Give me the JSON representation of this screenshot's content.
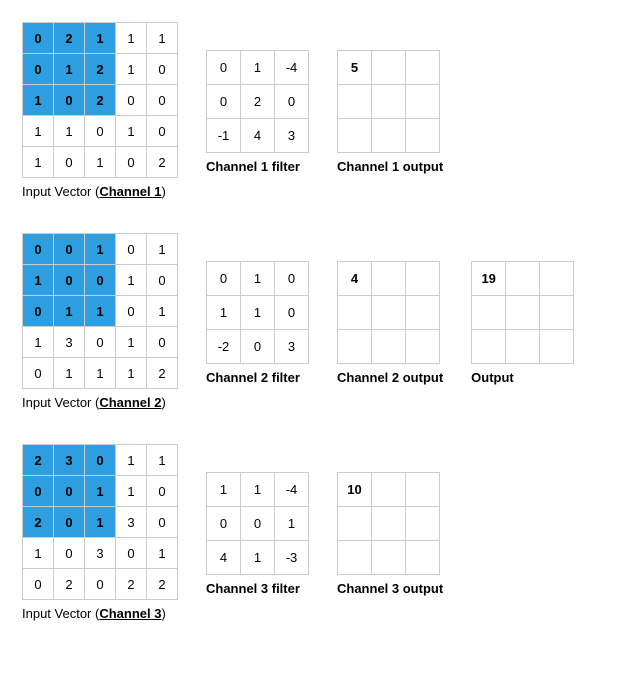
{
  "channels": [
    {
      "input": {
        "rows": [
          [
            0,
            2,
            1,
            1,
            1
          ],
          [
            0,
            1,
            2,
            1,
            0
          ],
          [
            1,
            0,
            2,
            0,
            0
          ],
          [
            1,
            1,
            0,
            1,
            0
          ],
          [
            1,
            0,
            1,
            0,
            2
          ]
        ],
        "highlight": [
          [
            0,
            0
          ],
          [
            0,
            1
          ],
          [
            0,
            2
          ],
          [
            1,
            0
          ],
          [
            1,
            1
          ],
          [
            1,
            2
          ],
          [
            2,
            0
          ],
          [
            2,
            1
          ],
          [
            2,
            2
          ]
        ],
        "caption_prefix": "Input Vector (",
        "caption_channel": "Channel 1",
        "caption_suffix": ")"
      },
      "filter": {
        "rows": [
          [
            0,
            1,
            -4
          ],
          [
            0,
            2,
            0
          ],
          [
            -1,
            4,
            3
          ]
        ],
        "caption": "Channel 1 filter"
      },
      "output": {
        "rows": [
          [
            5,
            "",
            ""
          ],
          [
            "",
            "",
            ""
          ],
          [
            "",
            "",
            ""
          ]
        ],
        "caption": "Channel 1 output"
      }
    },
    {
      "input": {
        "rows": [
          [
            0,
            0,
            1,
            0,
            1
          ],
          [
            1,
            0,
            0,
            1,
            0
          ],
          [
            0,
            1,
            1,
            0,
            1
          ],
          [
            1,
            3,
            0,
            1,
            0
          ],
          [
            0,
            1,
            1,
            1,
            2
          ]
        ],
        "highlight": [
          [
            0,
            0
          ],
          [
            0,
            1
          ],
          [
            0,
            2
          ],
          [
            1,
            0
          ],
          [
            1,
            1
          ],
          [
            1,
            2
          ],
          [
            2,
            0
          ],
          [
            2,
            1
          ],
          [
            2,
            2
          ]
        ],
        "caption_prefix": "Input Vector (",
        "caption_channel": "Channel 2",
        "caption_suffix": ")"
      },
      "filter": {
        "rows": [
          [
            0,
            1,
            0
          ],
          [
            1,
            1,
            0
          ],
          [
            -2,
            0,
            3
          ]
        ],
        "caption": "Channel 2 filter"
      },
      "output": {
        "rows": [
          [
            4,
            "",
            ""
          ],
          [
            "",
            "",
            ""
          ],
          [
            "",
            "",
            ""
          ]
        ],
        "caption": "Channel 2 output"
      },
      "final_output": {
        "rows": [
          [
            19,
            "",
            ""
          ],
          [
            "",
            "",
            ""
          ],
          [
            "",
            "",
            ""
          ]
        ],
        "caption": "Output"
      }
    },
    {
      "input": {
        "rows": [
          [
            2,
            3,
            0,
            1,
            1
          ],
          [
            0,
            0,
            1,
            1,
            0
          ],
          [
            2,
            0,
            1,
            3,
            0
          ],
          [
            1,
            0,
            3,
            0,
            1
          ],
          [
            0,
            2,
            0,
            2,
            2
          ]
        ],
        "highlight": [
          [
            0,
            0
          ],
          [
            0,
            1
          ],
          [
            0,
            2
          ],
          [
            1,
            0
          ],
          [
            1,
            1
          ],
          [
            1,
            2
          ],
          [
            2,
            0
          ],
          [
            2,
            1
          ],
          [
            2,
            2
          ]
        ],
        "caption_prefix": "Input Vector (",
        "caption_channel": "Channel 3",
        "caption_suffix": ")"
      },
      "filter": {
        "rows": [
          [
            1,
            1,
            -4
          ],
          [
            0,
            0,
            1
          ],
          [
            4,
            1,
            -3
          ]
        ],
        "caption": "Channel 3 filter"
      },
      "output": {
        "rows": [
          [
            10,
            "",
            ""
          ],
          [
            "",
            "",
            ""
          ],
          [
            "",
            "",
            ""
          ]
        ],
        "caption": "Channel 3 output"
      }
    }
  ],
  "chart_data": {
    "type": "table",
    "description": "CNN multi-channel convolution: three 5x5 input channels with 3x3 highlighted receptive field (top-left), three 3x3 filters, three 3x3 per-channel outputs (only top-left computed), and a 3x3 summed output.",
    "inputs": [
      [
        [
          0,
          2,
          1,
          1,
          1
        ],
        [
          0,
          1,
          2,
          1,
          0
        ],
        [
          1,
          0,
          2,
          0,
          0
        ],
        [
          1,
          1,
          0,
          1,
          0
        ],
        [
          1,
          0,
          1,
          0,
          2
        ]
      ],
      [
        [
          0,
          0,
          1,
          0,
          1
        ],
        [
          1,
          0,
          0,
          1,
          0
        ],
        [
          0,
          1,
          1,
          0,
          1
        ],
        [
          1,
          3,
          0,
          1,
          0
        ],
        [
          0,
          1,
          1,
          1,
          2
        ]
      ],
      [
        [
          2,
          3,
          0,
          1,
          1
        ],
        [
          0,
          0,
          1,
          1,
          0
        ],
        [
          2,
          0,
          1,
          3,
          0
        ],
        [
          1,
          0,
          3,
          0,
          1
        ],
        [
          0,
          2,
          0,
          2,
          2
        ]
      ]
    ],
    "filters": [
      [
        [
          0,
          1,
          -4
        ],
        [
          0,
          2,
          0
        ],
        [
          -1,
          4,
          3
        ]
      ],
      [
        [
          0,
          1,
          0
        ],
        [
          1,
          1,
          0
        ],
        [
          -2,
          0,
          3
        ]
      ],
      [
        [
          1,
          1,
          -4
        ],
        [
          0,
          0,
          1
        ],
        [
          4,
          1,
          -3
        ]
      ]
    ],
    "channel_outputs_topleft": [
      5,
      4,
      10
    ],
    "summed_output_topleft": 19
  }
}
